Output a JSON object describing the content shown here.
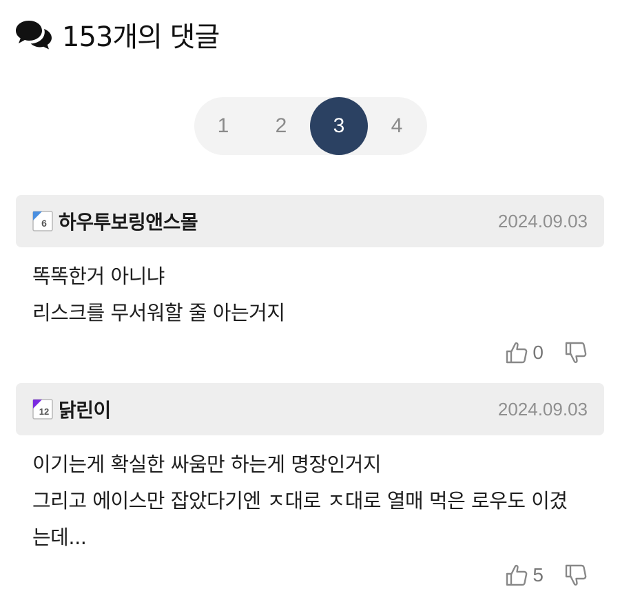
{
  "header": {
    "icon": "comments-icon",
    "title": "153개의 댓글"
  },
  "pagination": {
    "pages": [
      "1",
      "2",
      "3",
      "4"
    ],
    "current": "3",
    "active_color": "#2b4162"
  },
  "comments": [
    {
      "author": "하우투보링앤스몰",
      "level": "6",
      "level_color": "#4a8fe0",
      "date": "2024.09.03",
      "lines": [
        "똑똑한거 아니냐",
        "리스크를 무서워할 줄 아는거지"
      ],
      "likes": "0"
    },
    {
      "author": "닭린이",
      "level": "12",
      "level_color": "#7b2be0",
      "date": "2024.09.03",
      "lines": [
        "이기는게 확실한 싸움만 하는게 명장인거지",
        "그리고 에이스만 잡았다기엔 ㅈ대로 ㅈ대로 열매 먹은 로우도 이겼",
        "는데..."
      ],
      "likes": "5"
    }
  ]
}
